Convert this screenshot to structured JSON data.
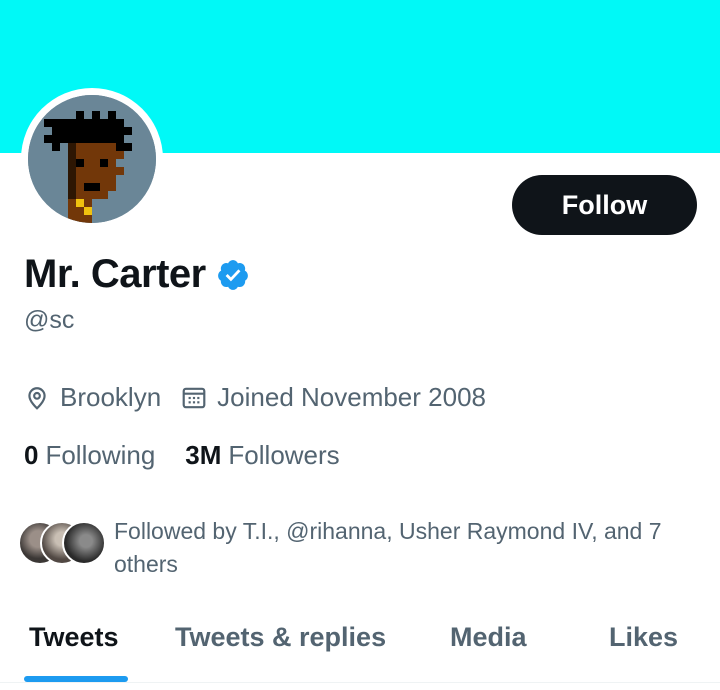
{
  "profile": {
    "display_name": "Mr. Carter",
    "handle": "@sc",
    "verified_icon": "verified-badge-icon",
    "location": "Brooklyn",
    "joined": "Joined November 2008",
    "follow_label": "Follow"
  },
  "stats": {
    "following_count": "0",
    "following_label": "Following",
    "followers_count": "3M",
    "followers_label": "Followers"
  },
  "followed_by": {
    "text": "Followed by T.I., @rihanna, Usher Raymond IV, and 7 others"
  },
  "tabs": [
    {
      "label": "Tweets",
      "active": true
    },
    {
      "label": "Tweets & replies",
      "active": false
    },
    {
      "label": "Media",
      "active": false
    },
    {
      "label": "Likes",
      "active": false
    }
  ],
  "colors": {
    "banner": "#00f9f7",
    "accent": "#1d9bf0",
    "text_primary": "#0f1419",
    "text_secondary": "#536471",
    "avatar_bg": "#6a8697"
  }
}
